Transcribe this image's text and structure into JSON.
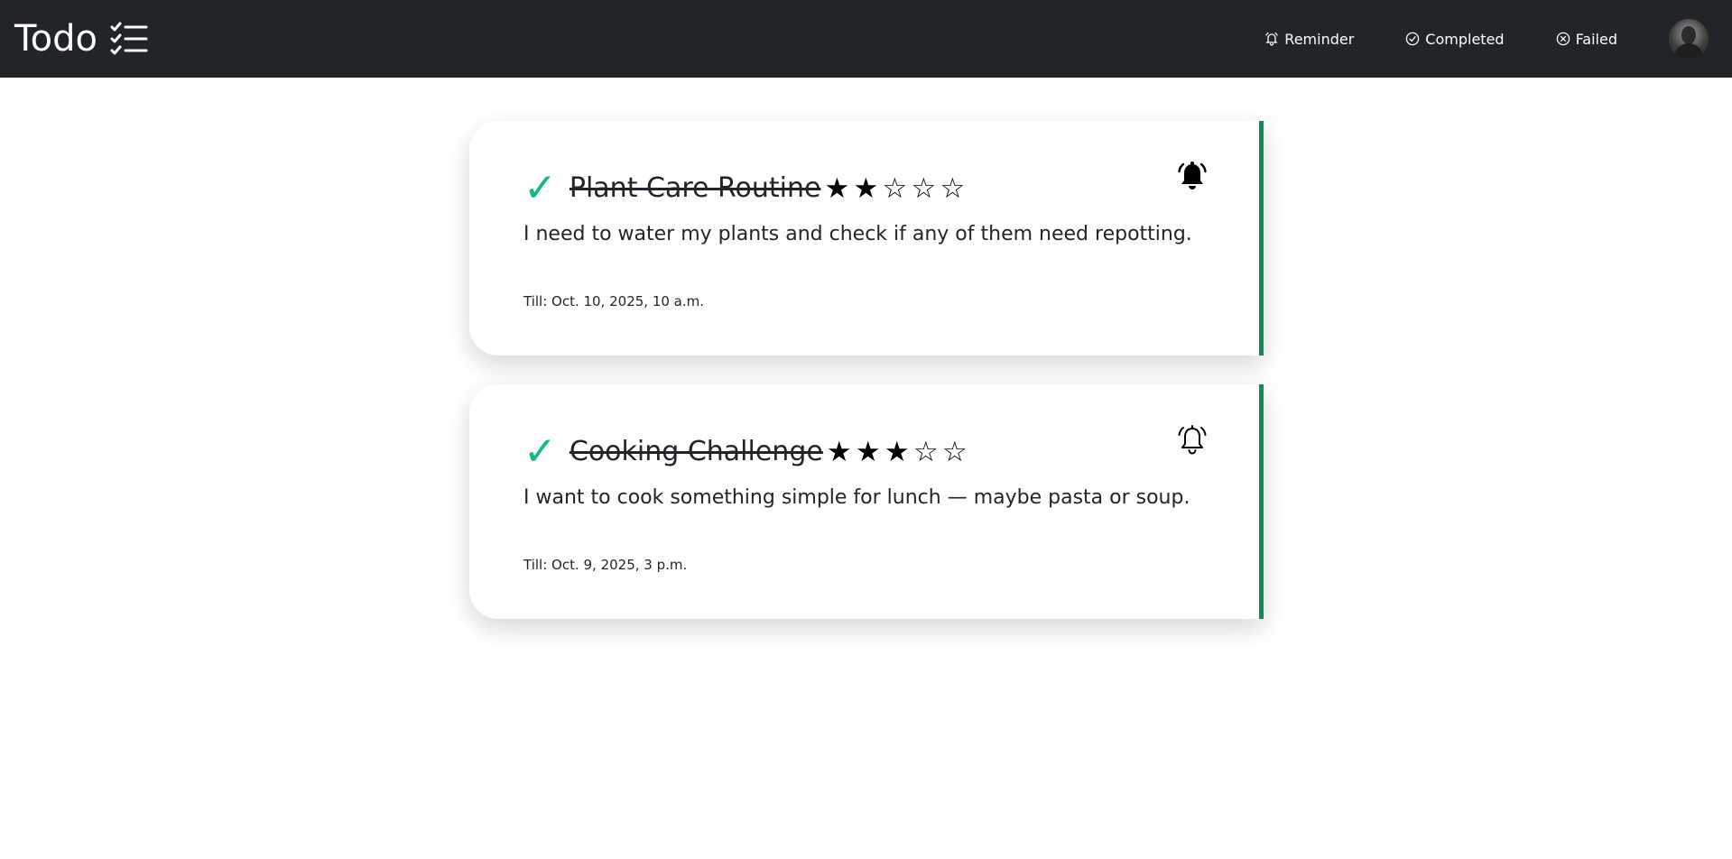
{
  "app": {
    "brand": "Todo",
    "brand_icon": "list-check-icon"
  },
  "nav": {
    "items": [
      {
        "label": "Reminder",
        "icon": "bell-icon"
      },
      {
        "label": "Completed",
        "icon": "check-circle-icon"
      },
      {
        "label": "Failed",
        "icon": "x-circle-icon"
      }
    ],
    "avatar": "user-avatar"
  },
  "tasks": [
    {
      "title": "Plant Care Routine",
      "status_icon": "checkmark",
      "check_glyph": "✓",
      "rating": 2,
      "rating_max": 5,
      "reminder_icon": "bell-filled-icon",
      "description": "I need to water my plants and check if any of them need repotting.",
      "due": "Till: Oct. 10, 2025, 10 a.m."
    },
    {
      "title": "Cooking Challenge",
      "status_icon": "checkmark",
      "check_glyph": "✓",
      "rating": 3,
      "rating_max": 5,
      "reminder_icon": "bell-outline-icon",
      "description": "I want to cook something simple for lunch — maybe pasta or soup.",
      "due": "Till: Oct. 9, 2025, 3 p.m."
    }
  ],
  "colors": {
    "navbar_bg": "#212529",
    "accent_bar": "#198754",
    "check": "#12b886"
  }
}
